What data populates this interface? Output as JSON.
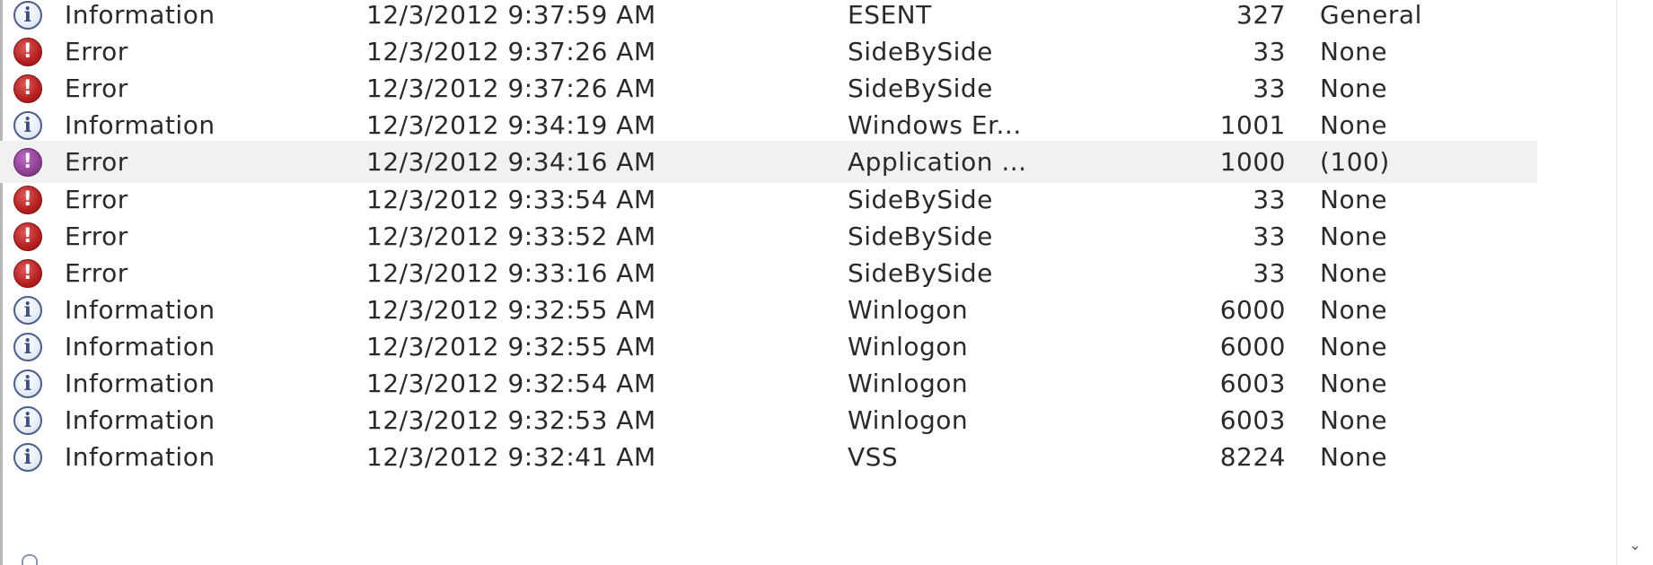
{
  "events": [
    {
      "level": "Information",
      "icon": "info-icon",
      "date": "12/3/2012 9:37:59 AM",
      "source": "ESENT",
      "event_id": "327",
      "task": "General",
      "selected": false
    },
    {
      "level": "Error",
      "icon": "error-icon",
      "date": "12/3/2012 9:37:26 AM",
      "source": "SideBySide",
      "event_id": "33",
      "task": "None",
      "selected": false
    },
    {
      "level": "Error",
      "icon": "error-icon",
      "date": "12/3/2012 9:37:26 AM",
      "source": "SideBySide",
      "event_id": "33",
      "task": "None",
      "selected": false
    },
    {
      "level": "Information",
      "icon": "info-icon",
      "date": "12/3/2012 9:34:19 AM",
      "source": "Windows Er...",
      "event_id": "1001",
      "task": "None",
      "selected": false
    },
    {
      "level": "Error",
      "icon": "error-icon",
      "date": "12/3/2012 9:34:16 AM",
      "source": "Application ...",
      "event_id": "1000",
      "task": "(100)",
      "selected": true
    },
    {
      "level": "Error",
      "icon": "error-icon",
      "date": "12/3/2012 9:33:54 AM",
      "source": "SideBySide",
      "event_id": "33",
      "task": "None",
      "selected": false
    },
    {
      "level": "Error",
      "icon": "error-icon",
      "date": "12/3/2012 9:33:52 AM",
      "source": "SideBySide",
      "event_id": "33",
      "task": "None",
      "selected": false
    },
    {
      "level": "Error",
      "icon": "error-icon",
      "date": "12/3/2012 9:33:16 AM",
      "source": "SideBySide",
      "event_id": "33",
      "task": "None",
      "selected": false
    },
    {
      "level": "Information",
      "icon": "info-icon",
      "date": "12/3/2012 9:32:55 AM",
      "source": "Winlogon",
      "event_id": "6000",
      "task": "None",
      "selected": false
    },
    {
      "level": "Information",
      "icon": "info-icon",
      "date": "12/3/2012 9:32:55 AM",
      "source": "Winlogon",
      "event_id": "6000",
      "task": "None",
      "selected": false
    },
    {
      "level": "Information",
      "icon": "info-icon",
      "date": "12/3/2012 9:32:54 AM",
      "source": "Winlogon",
      "event_id": "6003",
      "task": "None",
      "selected": false
    },
    {
      "level": "Information",
      "icon": "info-icon",
      "date": "12/3/2012 9:32:53 AM",
      "source": "Winlogon",
      "event_id": "6003",
      "task": "None",
      "selected": false
    },
    {
      "level": "Information",
      "icon": "info-icon",
      "date": "12/3/2012 9:32:41 AM",
      "source": "VSS",
      "event_id": "8224",
      "task": "None",
      "selected": false
    }
  ],
  "icons": {
    "info_glyph": "i",
    "error_glyph": "!",
    "scroll_down_glyph": "⌄"
  },
  "colors": {
    "info_border": "#4b5f88",
    "error_red": "#b51f1f",
    "selected_error": "#8e3f93",
    "selected_row_bg": "#f1f1f1"
  }
}
